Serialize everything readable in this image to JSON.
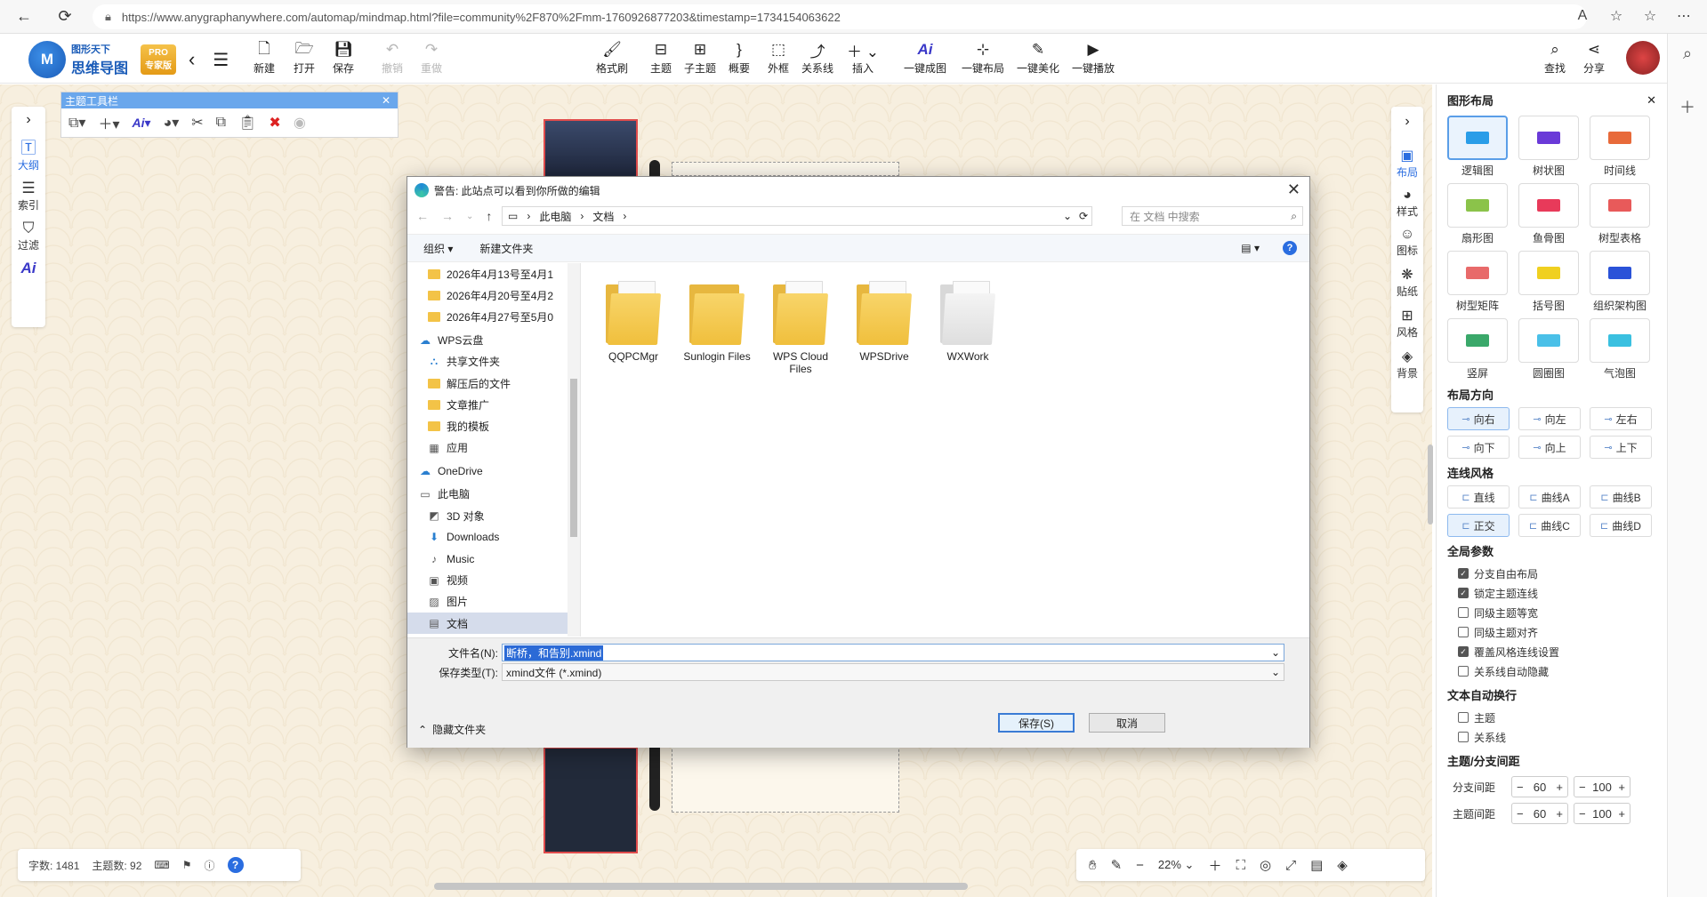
{
  "browser": {
    "url": "https://www.anygraphanywhere.com/automap/mindmap.html?file=community%2F870%2Fmm-1760926877203&timestamp=1734154063622"
  },
  "app": {
    "logo_small": "图形天下",
    "logo_big": "思维导图",
    "pro_top": "PRO",
    "pro_bottom": "专家版",
    "toolbar": {
      "new": "新建",
      "open": "打开",
      "save": "保存",
      "undo": "撤销",
      "redo": "重做",
      "format_brush": "格式刷",
      "topic": "主题",
      "subtopic": "子主题",
      "summary": "概要",
      "boundary": "外框",
      "relation": "关系线",
      "insert": "插入",
      "ai_generate": "一键成图",
      "auto_layout": "一键布局",
      "beautify": "一键美化",
      "play": "一键播放",
      "find": "查找",
      "share": "分享"
    }
  },
  "left_strip": {
    "outline": "大纲",
    "index": "索引",
    "filter": "过滤"
  },
  "topic_toolbar": {
    "title": "主题工具栏"
  },
  "right_strip": {
    "layout": "布局",
    "style": "样式",
    "icon": "图标",
    "sticker": "贴纸",
    "theme": "风格",
    "background": "背景"
  },
  "status": {
    "word_count": "字数: 1481",
    "topic_count": "主题数: 92"
  },
  "zoom": {
    "level": "22%"
  },
  "right_panel": {
    "title": "图形布局",
    "layouts": [
      "逻辑图",
      "树状图",
      "时间线",
      "扇形图",
      "鱼骨图",
      "树型表格",
      "树型矩阵",
      "括号图",
      "组织架构图",
      "竖屏",
      "圆圈图",
      "气泡图"
    ],
    "direction_title": "布局方向",
    "directions": [
      "向右",
      "向左",
      "左右",
      "向下",
      "向上",
      "上下"
    ],
    "line_title": "连线风格",
    "lines": [
      "直线",
      "曲线A",
      "曲线B",
      "正交",
      "曲线C",
      "曲线D"
    ],
    "global_title": "全局参数",
    "global_opts": [
      {
        "label": "分支自由布局",
        "checked": true
      },
      {
        "label": "锁定主题连线",
        "checked": true
      },
      {
        "label": "同级主题等宽",
        "checked": false
      },
      {
        "label": "同级主题对齐",
        "checked": false
      },
      {
        "label": "覆盖风格连线设置",
        "checked": true
      },
      {
        "label": "关系线自动隐藏",
        "checked": false
      }
    ],
    "wrap_title": "文本自动换行",
    "wrap_opts": [
      {
        "label": "主题",
        "checked": false
      },
      {
        "label": "关系线",
        "checked": false
      }
    ],
    "spacing_title": "主题/分支间距",
    "branch_spacing_label": "分支间距",
    "topic_spacing_label": "主题间距",
    "branch_spacing": [
      "60",
      "100"
    ],
    "topic_spacing": [
      "60",
      "100"
    ]
  },
  "dialog": {
    "title": "警告: 此站点可以看到你所做的编辑",
    "path": [
      "此电脑",
      "文档"
    ],
    "search_placeholder": "在 文档 中搜索",
    "organize": "组织",
    "new_folder": "新建文件夹",
    "tree": [
      {
        "label": "2026年4月13号至4月1",
        "type": "folder"
      },
      {
        "label": "2026年4月20号至4月2",
        "type": "folder"
      },
      {
        "label": "2026年4月27号至5月0",
        "type": "folder"
      },
      {
        "label": "WPS云盘",
        "type": "cloud"
      },
      {
        "label": "共享文件夹",
        "type": "share"
      },
      {
        "label": "解压后的文件",
        "type": "folder"
      },
      {
        "label": "文章推广",
        "type": "folder"
      },
      {
        "label": "我的模板",
        "type": "folder"
      },
      {
        "label": "应用",
        "type": "apps"
      },
      {
        "label": "OneDrive",
        "type": "cloud"
      },
      {
        "label": "此电脑",
        "type": "pc"
      },
      {
        "label": "3D 对象",
        "type": "3d"
      },
      {
        "label": "Downloads",
        "type": "download"
      },
      {
        "label": "Music",
        "type": "music"
      },
      {
        "label": "视频",
        "type": "video"
      },
      {
        "label": "图片",
        "type": "picture"
      },
      {
        "label": "文档",
        "type": "doc"
      }
    ],
    "files": [
      "QQPCMgr",
      "Sunlogin Files",
      "WPS Cloud Files",
      "WPSDrive",
      "WXWork"
    ],
    "filename_label": "文件名(N):",
    "filename_value": "断桥，和告别.xmind",
    "filetype_label": "保存类型(T):",
    "filetype_value": "xmind文件 (*.xmind)",
    "hide_folders": "隐藏文件夹",
    "save_btn": "保存(S)",
    "cancel_btn": "取消"
  }
}
